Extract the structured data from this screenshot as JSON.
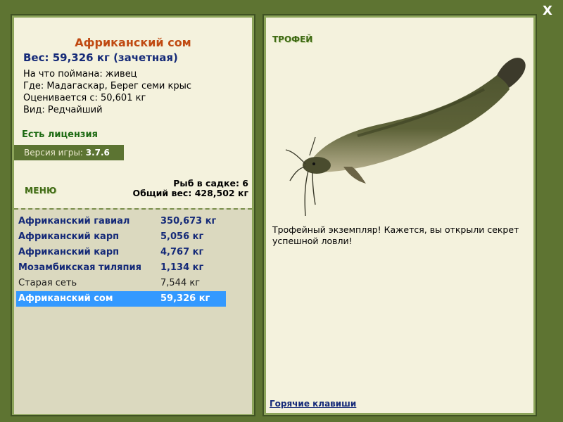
{
  "close": {
    "label": "X"
  },
  "fish": {
    "name": "Африканский сом",
    "weight_line": "Вес: 59,326 кг (зачетная)",
    "details": [
      "На что поймана: живец",
      "Где: Мадагаскар, Берег семи крыс",
      "Оценивается с: 50,601 кг",
      "Вид: Редчайший"
    ]
  },
  "license": "Есть лицензия",
  "version": {
    "label": "Версия игры:",
    "value": "3.7.6"
  },
  "menu_label": "МЕНЮ",
  "stats": {
    "count": "Рыб в садке: 6",
    "total": "Общий вес: 428,502 кг"
  },
  "catch_list": [
    {
      "name": "Африканский гавиал",
      "weight": "350,673 кг"
    },
    {
      "name": "Африканский карп",
      "weight": "5,056 кг"
    },
    {
      "name": "Африканский карп",
      "weight": "4,767 кг"
    },
    {
      "name": "Мозамбикская тиляпия",
      "weight": "1,134 кг"
    },
    {
      "name": "Старая сеть",
      "weight": "7,544 кг"
    },
    {
      "name": "Африканский сом",
      "weight": "59,326 кг"
    }
  ],
  "trophy": {
    "title": "ТРОФЕЙ",
    "description": "Трофейный экземпляр! Кажется, вы открыли секрет успешной ловли!"
  },
  "hotkeys_label": "Горячие клавиши",
  "colors": {
    "background": "#5e7432",
    "panel": "#f4f2dd",
    "fish_name": "#c04a12",
    "link_blue": "#152a78",
    "selected": "#3399ff",
    "license_green": "#1d6a12"
  }
}
